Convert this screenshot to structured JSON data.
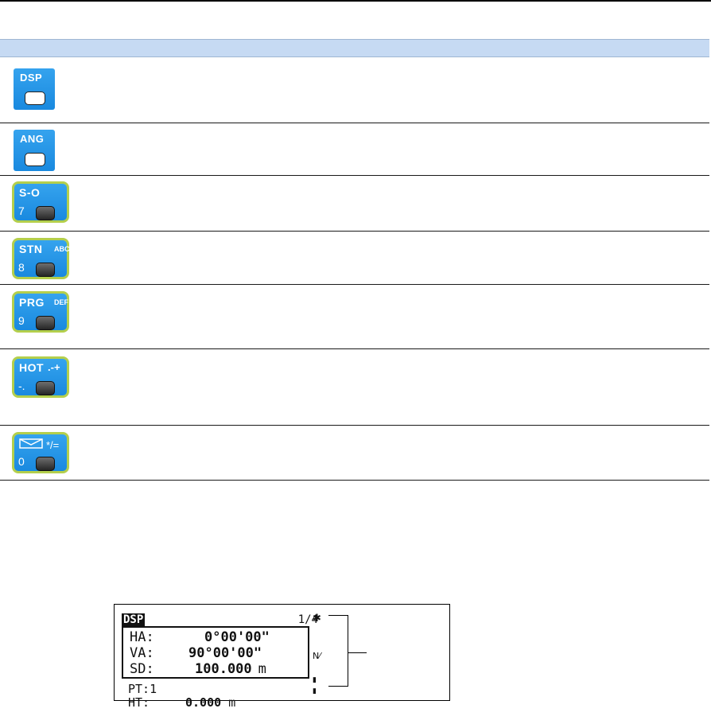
{
  "keys": [
    {
      "label": "DSP",
      "icon": "dsp-key-icon"
    },
    {
      "label": "ANG",
      "icon": "ang-key-icon"
    },
    {
      "label": "S-O",
      "number": "7",
      "icon": "stakeout-key-icon"
    },
    {
      "label": "STN",
      "sub": "ABC",
      "number": "8",
      "icon": "station-key-icon"
    },
    {
      "label": "PRG",
      "sub": "DEF",
      "number": "9",
      "icon": "program-key-icon"
    },
    {
      "label": "HOT",
      "sub": ".-+",
      "number": "-.",
      "icon": "hot-key-icon"
    },
    {
      "sub": "*/=",
      "number": "0",
      "icon": "envelope-level-key-icon"
    }
  ],
  "screen": {
    "mode": "DSP",
    "page": "1/4",
    "lines": [
      {
        "label": "HA:",
        "value": "0°00'00\"",
        "unit": ""
      },
      {
        "label": "VA:",
        "value": "90°00'00\"",
        "unit": ""
      },
      {
        "label": "SD:",
        "value": "100.000",
        "unit": "m"
      }
    ],
    "pt": "PT:1",
    "ht_label": "HT:",
    "ht_value": "0.000",
    "ht_unit": "m",
    "indicators": [
      "✱",
      "N⁄",
      "▮",
      "▮"
    ]
  },
  "colors": {
    "key_blue": "#1f90e3",
    "key_frame": "#b4cf4c",
    "header_band": "#c6daf3"
  }
}
